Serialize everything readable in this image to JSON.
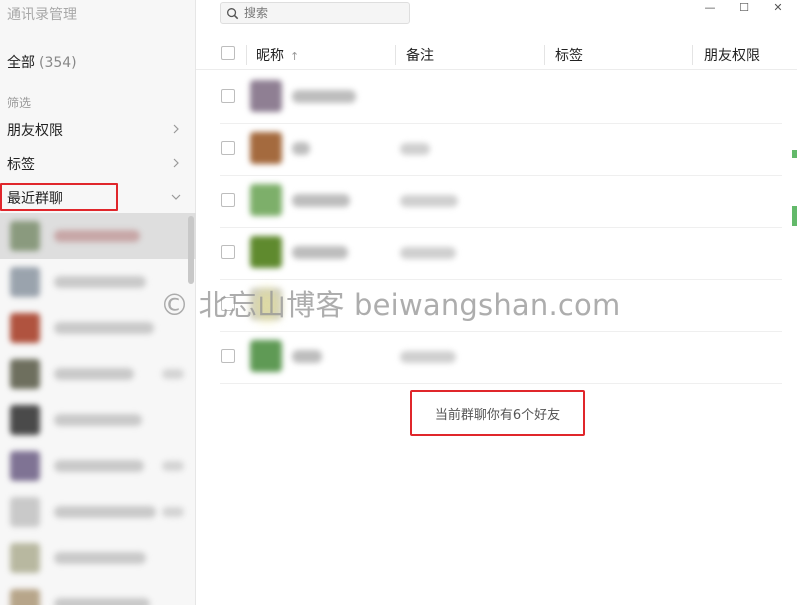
{
  "app_title": "通讯录管理",
  "sidebar": {
    "all_label": "全部",
    "all_count": "(354)",
    "filter_label": "筛选",
    "items": [
      {
        "label": "朋友权限",
        "chevron": "chevron-right-icon"
      },
      {
        "label": "标签",
        "chevron": "chevron-right-icon"
      },
      {
        "label": "最近群聊",
        "chevron": "chevron-down-icon"
      }
    ],
    "highlight_color": "#e0262b"
  },
  "search": {
    "placeholder": "搜索",
    "value": ""
  },
  "window_controls": {
    "minimize": "—",
    "maximize": "☐",
    "close": "✕"
  },
  "table": {
    "columns": {
      "nickname": "昵称",
      "remark": "备注",
      "tag": "标签",
      "permission": "朋友权限"
    },
    "sort_indicator": "↑"
  },
  "summary": {
    "text": "当前群聊你有6个好友"
  },
  "watermark": "© 北忘山博客 beiwangshan.com"
}
